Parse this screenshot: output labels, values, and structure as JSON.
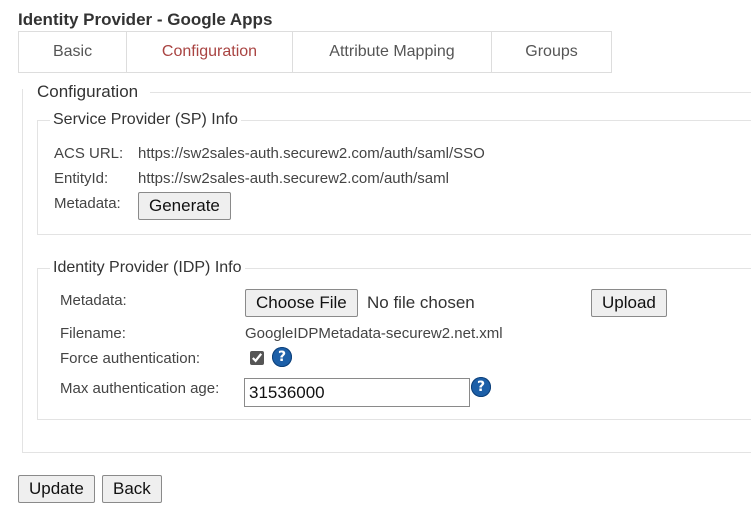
{
  "page": {
    "title": "Identity Provider - Google Apps"
  },
  "tabs": [
    {
      "label": "Basic",
      "active": false
    },
    {
      "label": "Configuration",
      "active": true
    },
    {
      "label": "Attribute Mapping",
      "active": false
    },
    {
      "label": "Groups",
      "active": false
    }
  ],
  "configuration": {
    "legend": "Configuration",
    "sp_info": {
      "legend": "Service Provider (SP) Info",
      "acs_url_label": "ACS URL:",
      "acs_url_value": "https://sw2sales-auth.securew2.com/auth/saml/SSO",
      "entity_id_label": "EntityId:",
      "entity_id_value": "https://sw2sales-auth.securew2.com/auth/saml",
      "metadata_label": "Metadata:",
      "generate_label": "Generate"
    },
    "idp_info": {
      "legend": "Identity Provider (IDP) Info",
      "metadata_label": "Metadata:",
      "choose_file_label": "Choose File",
      "no_file_text": "No file chosen",
      "upload_label": "Upload",
      "filename_label": "Filename:",
      "filename_value": "GoogleIDPMetadata-securew2.net.xml",
      "force_auth_label": "Force authentication:",
      "force_auth_checked": true,
      "max_age_label": "Max authentication age:",
      "max_age_value": "31536000",
      "help_glyph": "?"
    }
  },
  "footer": {
    "update_label": "Update",
    "back_label": "Back"
  },
  "icons": {
    "help": "help-circle-icon",
    "help_color": "#1c5fa8"
  },
  "colors": {
    "active_tab": "#a94442",
    "border": "#e3e3e3"
  }
}
